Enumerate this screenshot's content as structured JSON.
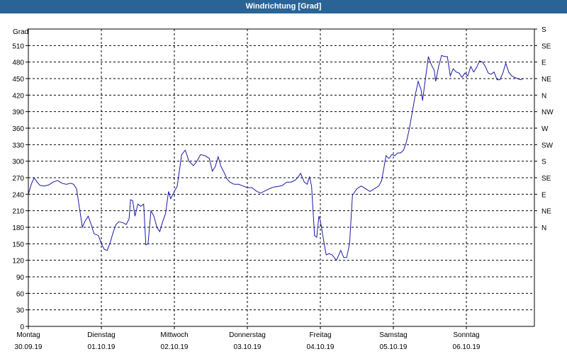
{
  "window": {
    "title": "Windrichtung [Grad]"
  },
  "chart_data": {
    "type": "line",
    "title": "Windrichtung [Grad]",
    "ylabel": "Grad",
    "ylim": [
      0,
      540
    ],
    "y_ticks": [
      0,
      30,
      60,
      90,
      120,
      150,
      180,
      210,
      240,
      270,
      300,
      330,
      360,
      390,
      420,
      450,
      480,
      510
    ],
    "y2_ticks": [
      "S",
      "SE",
      "E",
      "NE",
      "N",
      "NW",
      "W",
      "SW",
      "S",
      "SE",
      "E",
      "NE",
      "N"
    ],
    "y2_tick_values": [
      540,
      510,
      480,
      450,
      420,
      390,
      360,
      330,
      300,
      270,
      240,
      210,
      180
    ],
    "x_ticks": [
      {
        "day": "Montag",
        "date": "30.09.19",
        "x": 0
      },
      {
        "day": "Dienstag",
        "date": "01.10.19",
        "x": 1
      },
      {
        "day": "Mittwoch",
        "date": "02.10.19",
        "x": 2
      },
      {
        "day": "Donnerstag",
        "date": "03.10.19",
        "x": 3
      },
      {
        "day": "Freitag",
        "date": "04.10.19",
        "x": 4
      },
      {
        "day": "Samstag",
        "date": "05.10.19",
        "x": 5
      },
      {
        "day": "Sonntag",
        "date": "06.10.19",
        "x": 6
      }
    ],
    "xlim": [
      0,
      7
    ],
    "grid": true,
    "line_color": "#1a1aa6",
    "series": [
      {
        "points": [
          [
            0.0,
            240
          ],
          [
            0.04,
            258
          ],
          [
            0.08,
            270
          ],
          [
            0.12,
            262
          ],
          [
            0.16,
            256
          ],
          [
            0.22,
            255
          ],
          [
            0.28,
            257
          ],
          [
            0.34,
            262
          ],
          [
            0.4,
            265
          ],
          [
            0.46,
            260
          ],
          [
            0.52,
            258
          ],
          [
            0.58,
            260
          ],
          [
            0.62,
            258
          ],
          [
            0.66,
            250
          ],
          [
            0.74,
            180
          ],
          [
            0.78,
            192
          ],
          [
            0.82,
            200
          ],
          [
            0.86,
            185
          ],
          [
            0.9,
            168
          ],
          [
            0.96,
            165
          ],
          [
            1.0,
            150
          ],
          [
            1.04,
            140
          ],
          [
            1.08,
            138
          ],
          [
            1.12,
            152
          ],
          [
            1.16,
            170
          ],
          [
            1.2,
            185
          ],
          [
            1.24,
            190
          ],
          [
            1.3,
            188
          ],
          [
            1.34,
            185
          ],
          [
            1.38,
            195
          ],
          [
            1.4,
            230
          ],
          [
            1.43,
            228
          ],
          [
            1.46,
            200
          ],
          [
            1.5,
            222
          ],
          [
            1.54,
            218
          ],
          [
            1.58,
            222
          ],
          [
            1.61,
            148
          ],
          [
            1.64,
            150
          ],
          [
            1.68,
            210
          ],
          [
            1.72,
            200
          ],
          [
            1.76,
            180
          ],
          [
            1.8,
            172
          ],
          [
            1.84,
            190
          ],
          [
            1.88,
            205
          ],
          [
            1.92,
            245
          ],
          [
            1.95,
            232
          ],
          [
            1.98,
            240
          ],
          [
            2.04,
            255
          ],
          [
            2.1,
            312
          ],
          [
            2.15,
            320
          ],
          [
            2.2,
            300
          ],
          [
            2.26,
            292
          ],
          [
            2.3,
            298
          ],
          [
            2.36,
            312
          ],
          [
            2.42,
            310
          ],
          [
            2.48,
            305
          ],
          [
            2.52,
            282
          ],
          [
            2.56,
            290
          ],
          [
            2.6,
            308
          ],
          [
            2.64,
            290
          ],
          [
            2.68,
            280
          ],
          [
            2.72,
            268
          ],
          [
            2.76,
            262
          ],
          [
            2.82,
            258
          ],
          [
            2.88,
            258
          ],
          [
            2.94,
            255
          ],
          [
            3.0,
            252
          ],
          [
            3.06,
            252
          ],
          [
            3.12,
            246
          ],
          [
            3.18,
            242
          ],
          [
            3.24,
            246
          ],
          [
            3.3,
            250
          ],
          [
            3.36,
            253
          ],
          [
            3.42,
            254
          ],
          [
            3.48,
            256
          ],
          [
            3.54,
            262
          ],
          [
            3.6,
            262
          ],
          [
            3.66,
            266
          ],
          [
            3.7,
            272
          ],
          [
            3.73,
            278
          ],
          [
            3.78,
            262
          ],
          [
            3.82,
            258
          ],
          [
            3.85,
            272
          ],
          [
            3.88,
            255
          ],
          [
            3.92,
            165
          ],
          [
            3.95,
            162
          ],
          [
            3.98,
            200
          ],
          [
            4.0,
            192
          ],
          [
            4.04,
            160
          ],
          [
            4.08,
            130
          ],
          [
            4.12,
            132
          ],
          [
            4.16,
            130
          ],
          [
            4.22,
            120
          ],
          [
            4.28,
            138
          ],
          [
            4.32,
            125
          ],
          [
            4.36,
            125
          ],
          [
            4.4,
            150
          ],
          [
            4.44,
            238
          ],
          [
            4.5,
            250
          ],
          [
            4.56,
            255
          ],
          [
            4.62,
            250
          ],
          [
            4.68,
            245
          ],
          [
            4.74,
            250
          ],
          [
            4.8,
            255
          ],
          [
            4.84,
            265
          ],
          [
            4.9,
            310
          ],
          [
            4.94,
            305
          ],
          [
            4.98,
            312
          ],
          [
            5.02,
            310
          ],
          [
            5.06,
            315
          ],
          [
            5.1,
            315
          ],
          [
            5.14,
            320
          ],
          [
            5.18,
            335
          ],
          [
            5.22,
            360
          ],
          [
            5.26,
            390
          ],
          [
            5.3,
            420
          ],
          [
            5.34,
            445
          ],
          [
            5.38,
            430
          ],
          [
            5.4,
            410
          ],
          [
            5.44,
            450
          ],
          [
            5.48,
            490
          ],
          [
            5.52,
            475
          ],
          [
            5.56,
            465
          ],
          [
            5.58,
            445
          ],
          [
            5.62,
            472
          ],
          [
            5.66,
            492
          ],
          [
            5.7,
            490
          ],
          [
            5.74,
            490
          ],
          [
            5.78,
            455
          ],
          [
            5.82,
            468
          ],
          [
            5.86,
            462
          ],
          [
            5.9,
            460
          ],
          [
            5.94,
            452
          ],
          [
            5.98,
            460
          ],
          [
            6.02,
            455
          ],
          [
            6.06,
            472
          ],
          [
            6.1,
            462
          ],
          [
            6.14,
            470
          ],
          [
            6.18,
            482
          ],
          [
            6.22,
            480
          ],
          [
            6.26,
            472
          ],
          [
            6.3,
            460
          ],
          [
            6.34,
            458
          ],
          [
            6.38,
            462
          ],
          [
            6.42,
            448
          ],
          [
            6.46,
            448
          ],
          [
            6.5,
            460
          ],
          [
            6.54,
            478
          ],
          [
            6.58,
            462
          ],
          [
            6.62,
            455
          ],
          [
            6.66,
            452
          ],
          [
            6.7,
            450
          ],
          [
            6.74,
            448
          ],
          [
            6.78,
            450
          ]
        ]
      }
    ]
  }
}
